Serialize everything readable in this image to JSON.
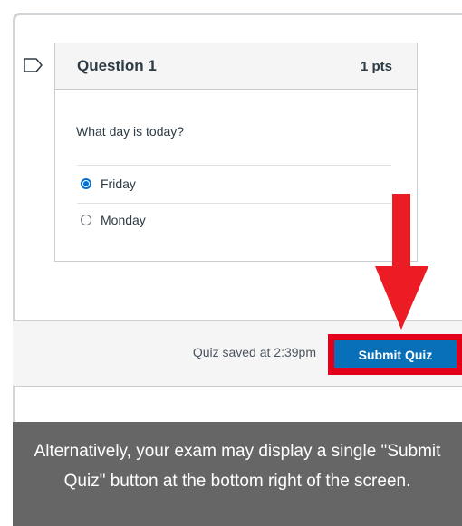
{
  "question": {
    "title": "Question 1",
    "points": "1 pts",
    "text": "What day is today?",
    "answers": [
      {
        "label": "Friday",
        "selected": true
      },
      {
        "label": "Monday",
        "selected": false
      }
    ]
  },
  "footer": {
    "saved_text": "Quiz saved at 2:39pm",
    "submit_label": "Submit Quiz"
  },
  "caption": {
    "text": "Alternatively, your exam may display a single \"Submit Quiz\" button at the bottom right of the screen."
  },
  "icons": {
    "flag": "flag-icon",
    "arrow": "red-down-arrow-icon"
  },
  "colors": {
    "primary_button": "#0770b8",
    "highlight": "#e2001a",
    "caption_background": "#666666"
  }
}
